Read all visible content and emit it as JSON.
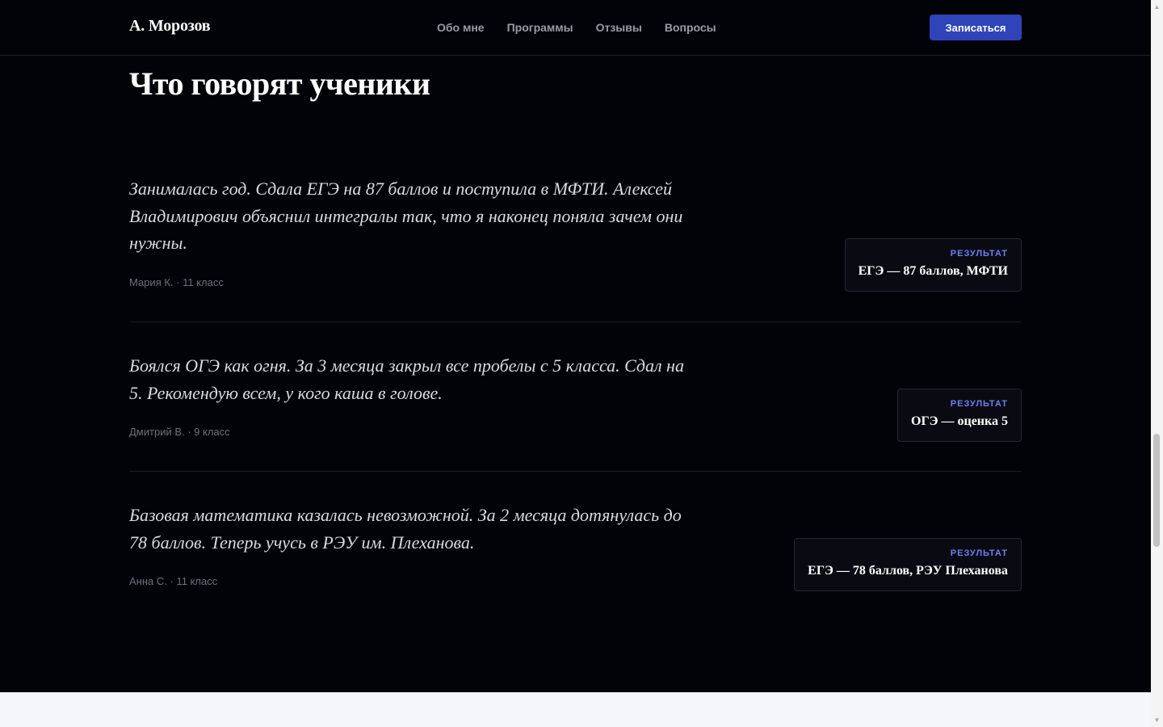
{
  "header": {
    "logo": "А. Морозов",
    "nav": [
      "Обо мне",
      "Программы",
      "Отзывы",
      "Вопросы"
    ],
    "cta": "Записаться"
  },
  "section": {
    "title": "Что говорят ученики"
  },
  "reviews": [
    {
      "quote": "Занималась год. Сдала ЕГЭ на 87 баллов и поступила в МФТИ. Алексей Владимирович объяснил интегралы так, что я наконец поняла зачем они нужны.",
      "author": "Мария К. · 11 класс",
      "badge_label": "РЕЗУЛЬТАТ",
      "badge_value": "ЕГЭ — 87 баллов, МФТИ"
    },
    {
      "quote": "Боялся ОГЭ как огня. За 3 месяца закрыл все пробелы с 5 класса. Сдал на 5. Рекомендую всем, у кого каша в голове.",
      "author": "Дмитрий В. · 9 класс",
      "badge_label": "РЕЗУЛЬТАТ",
      "badge_value": "ОГЭ — оценка 5"
    },
    {
      "quote": "Базовая математика казалась невозможной. За 2 месяца дотянулась до 78 баллов. Теперь учусь в РЭУ им. Плеханова.",
      "author": "Анна С. · 11 класс",
      "badge_label": "РЕЗУЛЬТАТ",
      "badge_value": "ЕГЭ — 78 баллов, РЭУ Плеханова"
    }
  ],
  "icons": {
    "scroll_up": "chevron-up-icon",
    "scroll_down": "chevron-down-icon"
  },
  "colors": {
    "background": "#020308",
    "accent": "#2f44b8",
    "badge_label": "#6c7ff2",
    "footer": "#f5f6fa"
  }
}
